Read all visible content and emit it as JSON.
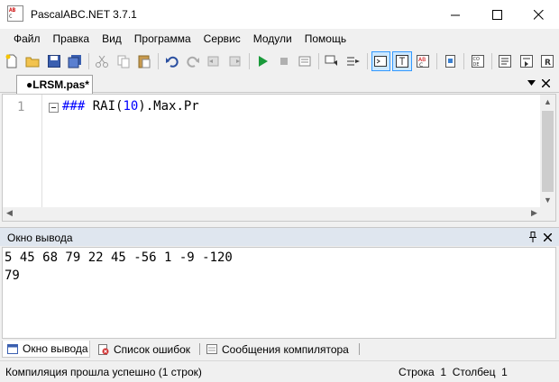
{
  "window": {
    "title": "PascalABC.NET 3.7.1",
    "logo_text": "AB C"
  },
  "menu": [
    "Файл",
    "Правка",
    "Вид",
    "Программа",
    "Сервис",
    "Модули",
    "Помощь"
  ],
  "toolbar": {
    "icons": [
      "new-file-icon",
      "open-folder-icon",
      "save-icon",
      "save-all-icon",
      "cut-icon",
      "copy-icon",
      "paste-icon",
      "undo-icon",
      "redo-icon",
      "indent-left-icon",
      "indent-right-icon",
      "run-icon",
      "stop-icon",
      "debug-step-icon",
      "comment-icon",
      "uncomment-icon",
      "console-icon",
      "text-window-icon",
      "abc-icon",
      "find-icon",
      "code-template-icon",
      "run-to-cursor-icon",
      "step-into-icon",
      "step-over-icon"
    ]
  },
  "editor": {
    "tab_label": "●LRSM.pas*",
    "line_number": "1",
    "code": {
      "prefix": "### ",
      "call": "RAI(",
      "arg": "10",
      "suffix": ").Max.Pr"
    }
  },
  "output_panel": {
    "title": "Окно вывода",
    "lines": [
      "5 45 68 79 22 45 -56 1 -9 -120",
      "79"
    ]
  },
  "bottom_tabs": [
    "Окно вывода",
    "Список ошибок",
    "Сообщения компилятора"
  ],
  "status": {
    "message": "Компиляция прошла успешно (1 строк)",
    "row_label": "Строка",
    "row": "1",
    "col_label": "Столбец",
    "col": "1"
  },
  "colors": {
    "accent": "#3399ff",
    "keyword": "#0000ff",
    "panel_header": "#dfe6ef"
  }
}
